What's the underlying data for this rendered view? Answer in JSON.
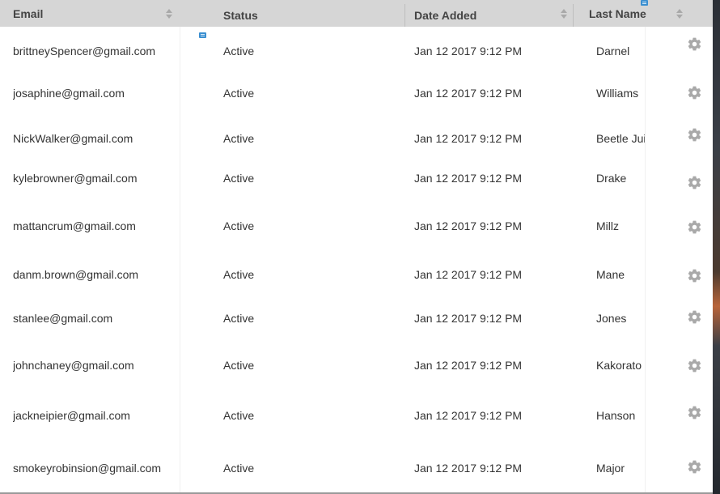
{
  "table": {
    "columns": {
      "email": "Email",
      "status": "Status",
      "date_added": "Date Added",
      "last_name": "Last Name"
    },
    "rows": [
      {
        "email": "brittneySpencer@gmail.com",
        "status": "Active",
        "date_added": "Jan 12 2017 9:12 PM",
        "last_name": "Darnel"
      },
      {
        "email": "josaphine@gmail.com",
        "status": "Active",
        "date_added": "Jan 12 2017 9:12 PM",
        "last_name": "Williams"
      },
      {
        "email": "NickWalker@gmail.com",
        "status": "Active",
        "date_added": "Jan 12 2017 9:12 PM",
        "last_name": "Beetle Juice"
      },
      {
        "email": "kylebrowner@gmail.com",
        "status": "Active",
        "date_added": "Jan 12 2017 9:12 PM",
        "last_name": "Drake"
      },
      {
        "email": "mattancrum@gmail.com",
        "status": "Active",
        "date_added": "Jan 12 2017 9:12 PM",
        "last_name": "Millz"
      },
      {
        "email": "danm.brown@gmail.com",
        "status": "Active",
        "date_added": "Jan 12 2017 9:12 PM",
        "last_name": "Mane"
      },
      {
        "email": "stanlee@gmail.com",
        "status": "Active",
        "date_added": "Jan 12 2017 9:12 PM",
        "last_name": "Jones"
      },
      {
        "email": "johnchaney@gmail.com",
        "status": "Active",
        "date_added": "Jan 12 2017 9:12 PM",
        "last_name": "Kakorato"
      },
      {
        "email": "jackneipier@gmail.com",
        "status": "Active",
        "date_added": "Jan 12 2017 9:12 PM",
        "last_name": "Hanson"
      },
      {
        "email": "smokeyrobinsion@gmail.com",
        "status": "Active",
        "date_added": "Jan 12 2017 9:12 PM",
        "last_name": "Major"
      }
    ],
    "row_action_icon": "gear-icon",
    "column_note_icon": "note-icon",
    "sort_icon": "sort-arrows-icon"
  },
  "colors": {
    "header_bg": "#d6d6d6",
    "text": "#333333",
    "icon_gray": "#a9a9a9",
    "note_blue": "#3b8fd0"
  }
}
